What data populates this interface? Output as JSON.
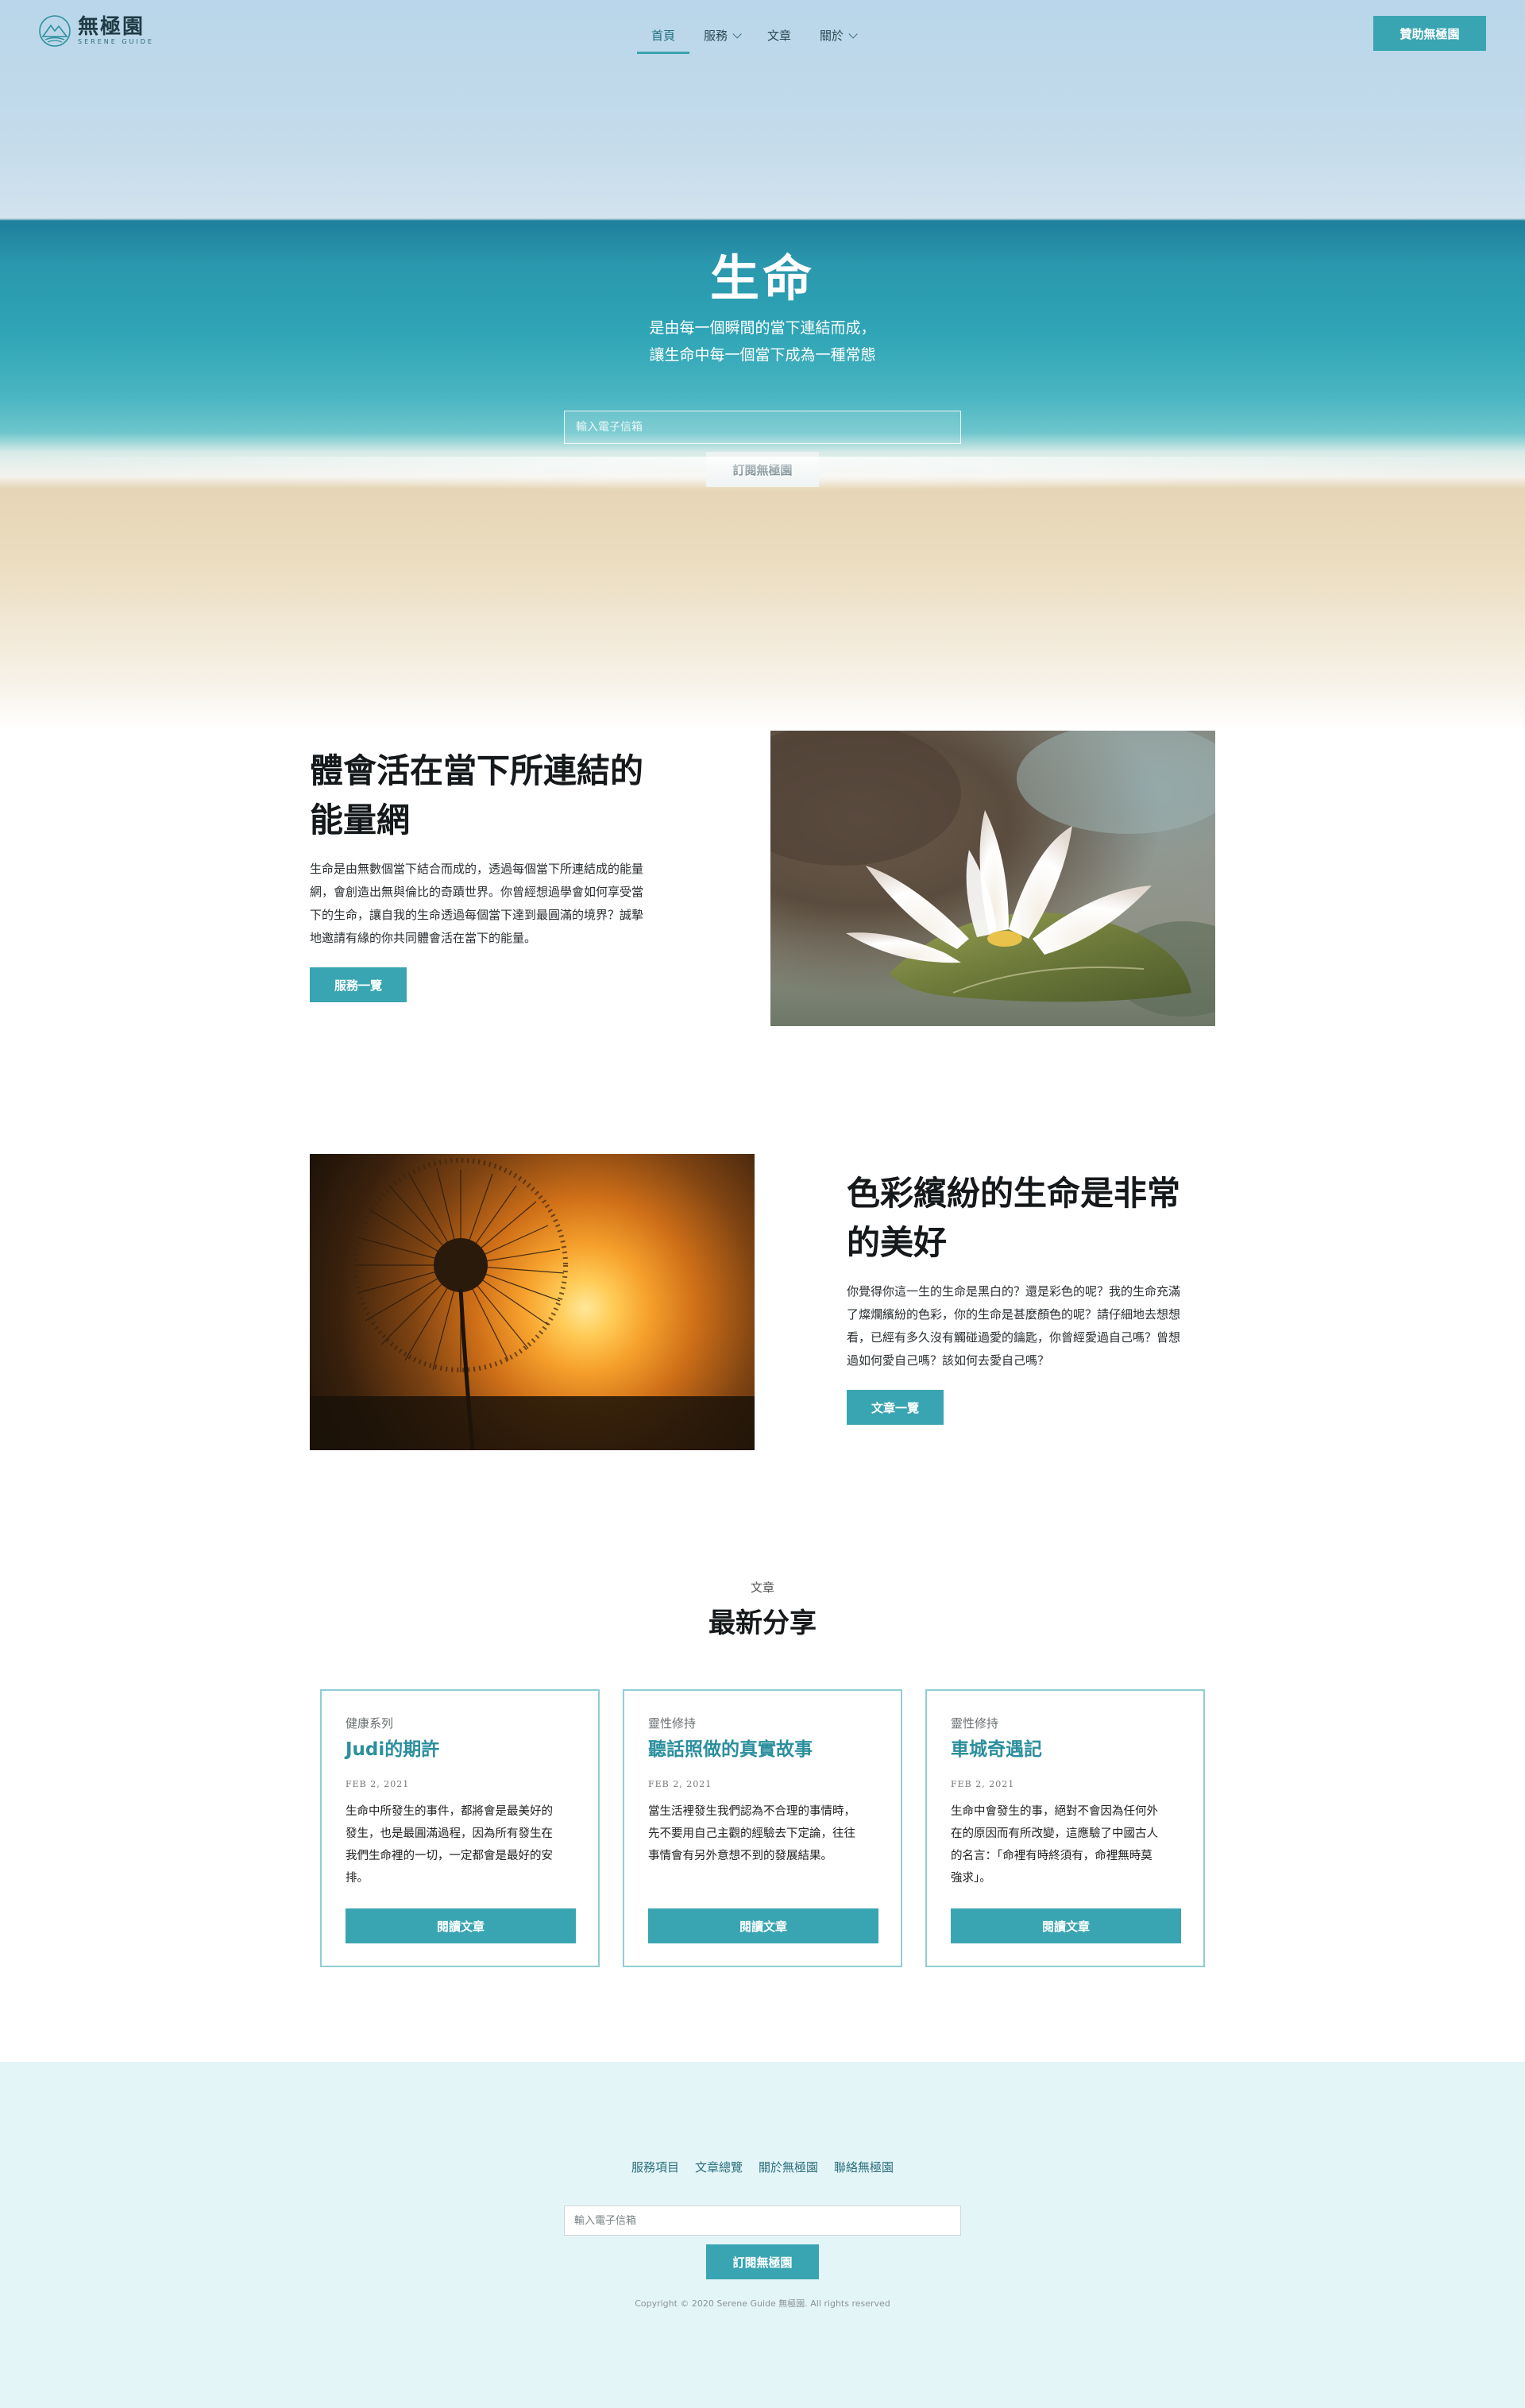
{
  "brand": {
    "name": "無極園",
    "tagline": "SERENE GUIDE"
  },
  "nav": {
    "items": [
      {
        "label": "首頁",
        "active": true,
        "has_dropdown": false
      },
      {
        "label": "服務",
        "active": false,
        "has_dropdown": true
      },
      {
        "label": "文章",
        "active": false,
        "has_dropdown": false
      },
      {
        "label": "關於",
        "active": false,
        "has_dropdown": true
      }
    ],
    "donate_label": "贊助無極園"
  },
  "hero": {
    "title": "生命",
    "subtitle_line1": "是由每一個瞬間的當下連結而成，",
    "subtitle_line2": "讓生命中每一個當下成為一種常態",
    "email_placeholder": "輸入電子信箱",
    "subscribe_label": "訂閱無極園"
  },
  "feature1": {
    "title_line1": "體會活在當下所連結的",
    "title_line2": "能量網",
    "body_lines": [
      "生命是由無數個當下結合而成的，透過每個當下所連結成的能量",
      "網，會創造出無與倫比的奇蹟世界。你曾經想過學會如何享受當",
      "下的生命，讓自我的生命透過每個當下達到最圓滿的境界？誠摯",
      "地邀請有緣的你共同體會活在當下的能量。"
    ],
    "button_label": "服務一覽"
  },
  "feature2": {
    "title_line1": "色彩繽紛的生命是非常",
    "title_line2": "的美好",
    "body_lines": [
      "你覺得你這一生的生命是黑白的？還是彩色的呢？我的生命充滿",
      "了燦爛繽紛的色彩，你的生命是甚麼顏色的呢？請仔細地去想想",
      "看，已經有多久沒有觸碰過愛的鑰匙，你曾經愛過自己嗎？曾想",
      "過如何愛自己嗎？該如何去愛自己嗎？"
    ],
    "button_label": "文章一覽"
  },
  "articles": {
    "section_label": "文章",
    "section_title": "最新分享",
    "cards": [
      {
        "category": "健康系列",
        "title": "Judi的期許",
        "date": "FEB 2, 2021",
        "lines": [
          "生命中所發生的事件，都將會是最美好的",
          "發生，也是最圓滿過程，因為所有發生在",
          "我們生命裡的一切，一定都會是最好的安",
          "排。"
        ],
        "button_label": "閱讀文章"
      },
      {
        "category": "靈性修持",
        "title": "聽話照做的真實故事",
        "date": "FEB 2, 2021",
        "lines": [
          "當生活裡發生我們認為不合理的事情時，",
          "先不要用自己主觀的經驗去下定論，往往",
          "事情會有另外意想不到的發展結果。"
        ],
        "button_label": "閱讀文章"
      },
      {
        "category": "靈性修持",
        "title": "車城奇遇記",
        "date": "FEB 2, 2021",
        "lines": [
          "生命中會發生的事，絕對不會因為任何外",
          "在的原因而有所改變，這應驗了中國古人",
          "的名言：「命裡有時終須有，命裡無時莫",
          "強求」。"
        ],
        "button_label": "閱讀文章"
      }
    ]
  },
  "footer": {
    "links": [
      "服務項目",
      "文章總覽",
      "關於無極園",
      "聯絡無極園"
    ],
    "email_placeholder": "輸入電子信箱",
    "subscribe_label": "訂閱無極園",
    "copyright": "Copyright © 2020 Serene Guide 無極園. All rights reserved"
  },
  "icons": {
    "logo": "mountain-sun-logo-icon",
    "dropdown": "chevron-down-icon"
  },
  "colors": {
    "accent": "#3aa5b2",
    "footer_bg": "#e4f5f8",
    "card_border": "#8fcdd4"
  }
}
